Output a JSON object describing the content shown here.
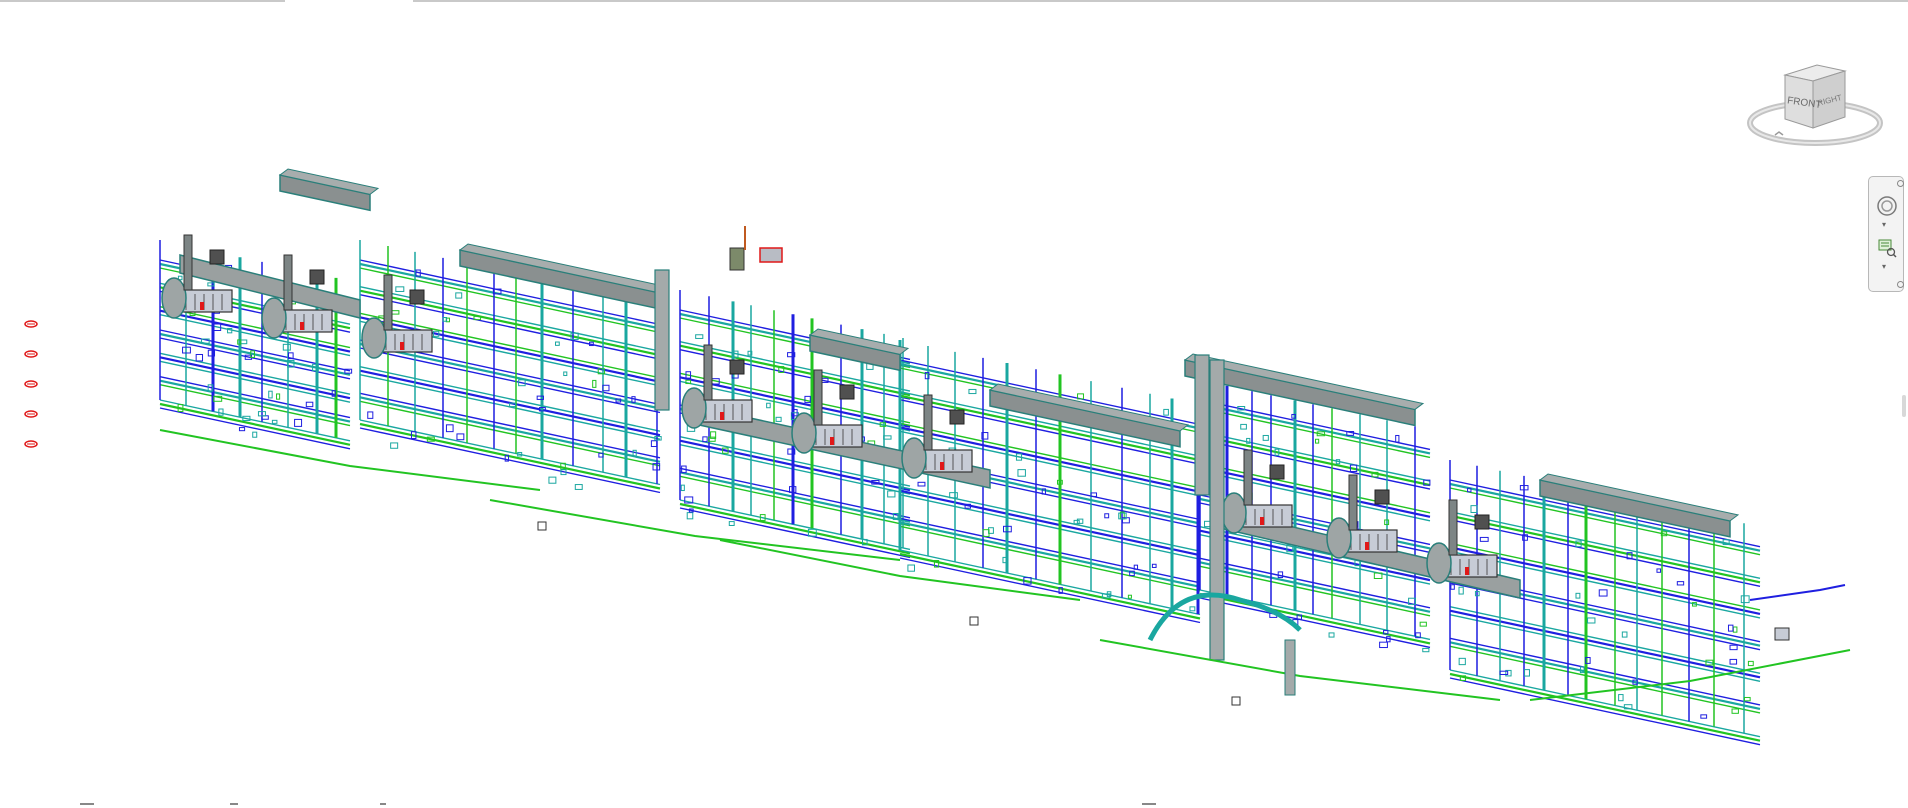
{
  "viewport": {
    "background": "#ffffff",
    "description_label": ""
  },
  "viewcube": {
    "front_label": "FRONT",
    "right_label": "RIGHT",
    "face_color": "#d9d9d9",
    "ring_color": "#bdbdbd"
  },
  "model_colors": {
    "duct_gray": "#8a9090",
    "duct_dark": "#6e7676",
    "pipe_blue": "#1f1fe0",
    "pipe_teal": "#1aa7a0",
    "pipe_green": "#22c422",
    "unit_light": "#c7ccd6",
    "stack_dark": "#505050",
    "accent_red": "#e01818"
  },
  "nav_bar": {
    "wheel_icon": "steering-wheel-icon",
    "zoom_icon": "zoom-region-icon"
  },
  "left_markers": {
    "count": 5,
    "icon": "red-section-marker-icon",
    "color": "#e01818"
  }
}
